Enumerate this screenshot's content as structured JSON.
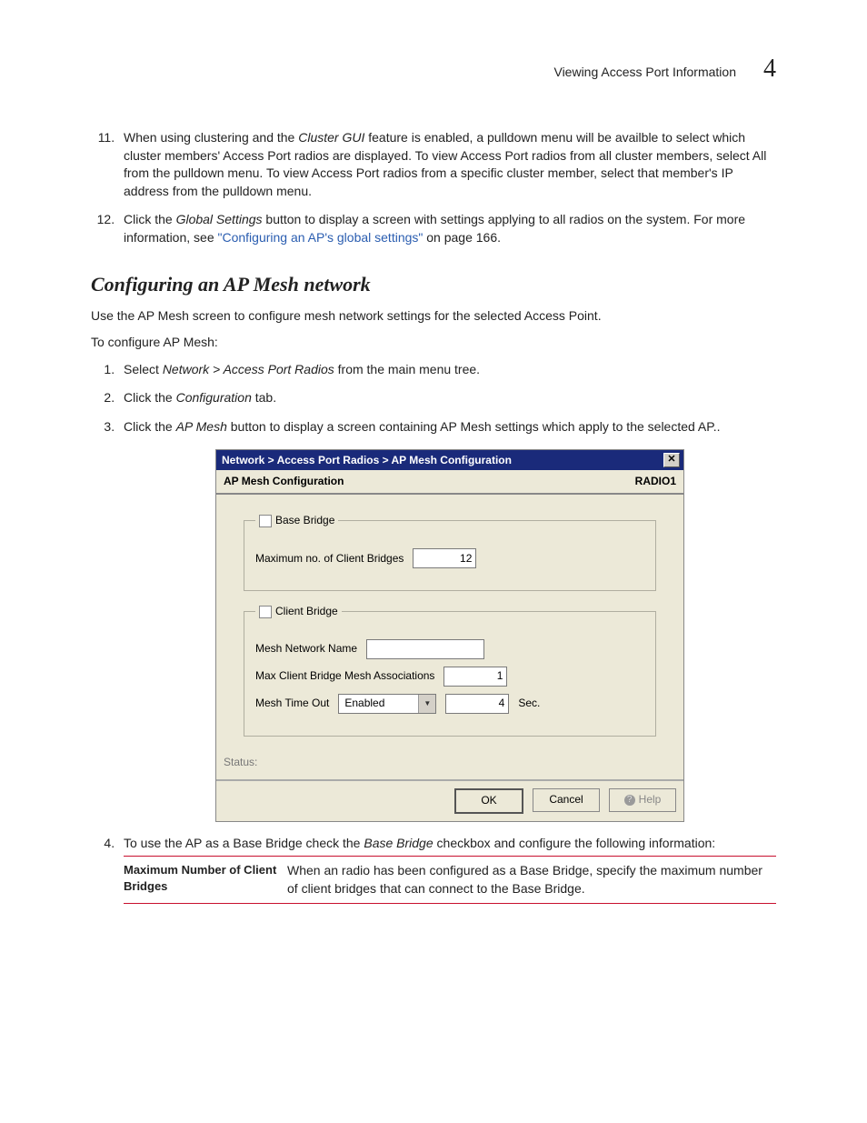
{
  "header": {
    "title": "Viewing Access Port Information",
    "chapter": "4"
  },
  "step11": {
    "pre": "When using clustering and the ",
    "i1": "Cluster GUI",
    "post": " feature is enabled, a pulldown menu will be availble to select which cluster members' Access Port radios are displayed. To view Access Port radios from all cluster members, select All from the pulldown menu. To view Access Port radios from a specific cluster member, select that member's IP address from the pulldown menu."
  },
  "step12": {
    "pre": "Click the ",
    "i1": "Global Settings",
    "mid": " button to display a screen with settings applying to all radios on the system. For more information, see ",
    "link": "\"Configuring an AP's global settings\"",
    "post": " on page 166."
  },
  "heading": "Configuring an AP Mesh network",
  "intro1": "Use the AP Mesh screen to configure mesh network settings for the selected Access Point.",
  "intro2": "To configure AP Mesh:",
  "sub1": {
    "pre": "Select ",
    "i1": "Network > Access Port Radios",
    "post": " from the main menu tree."
  },
  "sub2": {
    "pre": "Click the ",
    "i1": "Configuration",
    "post": " tab."
  },
  "sub3": {
    "pre": "Click the ",
    "i1": "AP Mesh",
    "post": " button to display a screen containing AP Mesh settings which apply to the selected AP.."
  },
  "dialog": {
    "title": "Network > Access Port Radios > AP Mesh Configuration",
    "close": "✕",
    "sub_left": "AP Mesh Configuration",
    "sub_right": "RADIO1",
    "base_bridge_legend": "Base Bridge",
    "max_client_bridges_label": "Maximum no. of Client Bridges",
    "max_client_bridges_value": "12",
    "client_bridge_legend": "Client Bridge",
    "mesh_name_label": "Mesh Network Name",
    "mesh_name_value": "",
    "max_assoc_label": "Max Client Bridge Mesh Associations",
    "max_assoc_value": "1",
    "timeout_label": "Mesh Time Out",
    "timeout_select": "Enabled",
    "timeout_value": "4",
    "timeout_unit": "Sec.",
    "status_label": "Status:",
    "ok": "OK",
    "cancel": "Cancel",
    "help": "Help"
  },
  "sub4": {
    "pre": "To use the AP as a Base Bridge check the ",
    "i1": "Base Bridge",
    "post": " checkbox and configure the following information:"
  },
  "table": {
    "term": "Maximum Number of Client Bridges",
    "desc": "When an radio has been configured as a Base Bridge, specify the maximum number of client bridges that can connect to the Base Bridge."
  }
}
